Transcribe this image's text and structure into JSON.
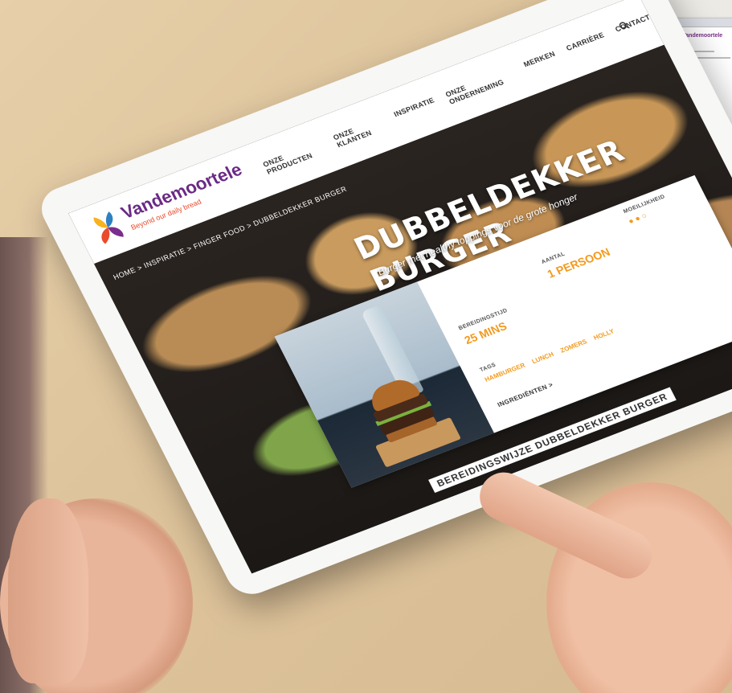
{
  "brand": {
    "name": "Vandemoortele",
    "tagline": "Beyond our daily bread"
  },
  "nav": {
    "items": [
      "ONZE PRODUCTEN",
      "ONZE KLANTEN",
      "INSPIRATIE",
      "ONZE ONDERNEMING",
      "MERKEN",
      "CARRIÈRE",
      "CONTACT"
    ]
  },
  "breadcrumb": "HOME > INSPIRATIE > FINGER FOOD > DUBBELDEKKER BURGER",
  "hero": {
    "title": "DUBBELDEKKER BURGER",
    "subtitle": "Burger met healthy toppings voor de grote honger"
  },
  "recipe": {
    "prep_label": "BEREIDINGSTIJD",
    "prep_value": "25 MINS",
    "persons_label": "AANTAL",
    "persons_value": "1 PERSOON",
    "difficulty_label": "MOEILIJKHEID",
    "tags_label": "TAGS",
    "tags": [
      "HAMBURGER",
      "LUNCH",
      "ZOMERS",
      "HOLLY"
    ],
    "ingredients_label": "INGREDIËNTEN >"
  },
  "footer": {
    "title": "BEREIDINGSWIJZE DUBBELDEKKER BURGER"
  },
  "inset": {
    "brand": "Vandemoortele"
  },
  "colors": {
    "brand_purple": "#6b2a86",
    "accent_orange": "#f39a1c"
  }
}
